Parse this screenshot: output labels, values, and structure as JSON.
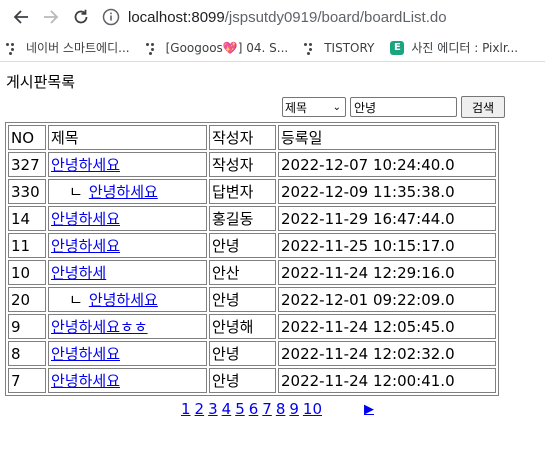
{
  "browser": {
    "url_host": "localhost:8099",
    "url_path": "/jspsutdy0919/board/boardList.do",
    "bookmarks": [
      {
        "label": "네이버 스마트에디...",
        "icon": "dots-icon"
      },
      {
        "label": "[Googoos💖] 04. S...",
        "icon": "dots-icon"
      },
      {
        "label": "TISTORY",
        "icon": "dots-icon"
      },
      {
        "label": "사진 에디터 : Pixlr...",
        "icon": "e-badge-icon"
      }
    ],
    "bookmark_badge_letter": "E"
  },
  "page": {
    "title": "게시판목록"
  },
  "search": {
    "field_selected": "제목",
    "query": "안녕",
    "button_label": "검색"
  },
  "table": {
    "headers": {
      "no": "NO",
      "title": "제목",
      "writer": "작성자",
      "date": "등록일"
    },
    "reply_marker": "ㄴ",
    "rows": [
      {
        "no": "327",
        "title": "안녕하세요",
        "reply": false,
        "writer": "작성자",
        "date": "2022-12-07 10:24:40.0"
      },
      {
        "no": "330",
        "title": "안녕하세요",
        "reply": true,
        "writer": "답변자",
        "date": "2022-12-09 11:35:38.0"
      },
      {
        "no": "14",
        "title": "안녕하세요",
        "reply": false,
        "writer": "홍길동",
        "date": "2022-11-29 16:47:44.0"
      },
      {
        "no": "11",
        "title": "안녕하세요",
        "reply": false,
        "writer": "안녕",
        "date": "2022-11-25 10:15:17.0"
      },
      {
        "no": "10",
        "title": "안녕하세",
        "reply": false,
        "writer": "안산",
        "date": "2022-11-24 12:29:16.0"
      },
      {
        "no": "20",
        "title": "안녕하세요",
        "reply": true,
        "writer": "안녕",
        "date": "2022-12-01 09:22:09.0"
      },
      {
        "no": "9",
        "title": "안녕하세요ㅎㅎ",
        "reply": false,
        "writer": "안녕해",
        "date": "2022-11-24 12:05:45.0"
      },
      {
        "no": "8",
        "title": "안녕하세요",
        "reply": false,
        "writer": "안녕",
        "date": "2022-11-24 12:02:32.0"
      },
      {
        "no": "7",
        "title": "안녕하세요",
        "reply": false,
        "writer": "안녕",
        "date": "2022-11-24 12:00:41.0"
      }
    ]
  },
  "pagination": {
    "pages": [
      "1",
      "2",
      "3",
      "4",
      "5",
      "6",
      "7",
      "8",
      "9",
      "10"
    ],
    "next_label": "▶"
  }
}
